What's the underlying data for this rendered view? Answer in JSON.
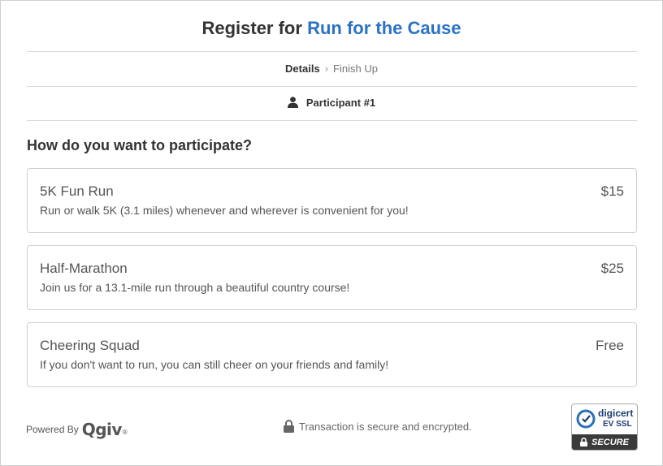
{
  "header": {
    "title_prefix": "Register for",
    "event_name": "Run for the Cause"
  },
  "steps": {
    "current": "Details",
    "separator": "›",
    "next": "Finish Up"
  },
  "participant": {
    "label": "Participant #1",
    "icon": "person-icon"
  },
  "question": "How do you want to participate?",
  "options": [
    {
      "name": "5K Fun Run",
      "price": "$15",
      "description": "Run or walk 5K (3.1 miles) whenever and wherever is convenient for you!"
    },
    {
      "name": "Half-Marathon",
      "price": "$25",
      "description": "Join us for a 13.1-mile run through a beautiful country course!"
    },
    {
      "name": "Cheering Squad",
      "price": "Free",
      "description": "If you don't want to run, you can still cheer on your friends and family!"
    }
  ],
  "footer": {
    "powered_by": "Powered By",
    "logo_text": "Qgiv",
    "logo_mark": "®",
    "secure_text": "Transaction is secure and encrypted.",
    "secure_icon": "lock-icon",
    "badge": {
      "brand": "digicert",
      "label": "EV SSL",
      "secure": "SECURE"
    }
  },
  "colors": {
    "accent": "#2a72c8",
    "text": "#333333",
    "border": "#cfcfcf",
    "badge_brand": "#1d3c6e"
  }
}
